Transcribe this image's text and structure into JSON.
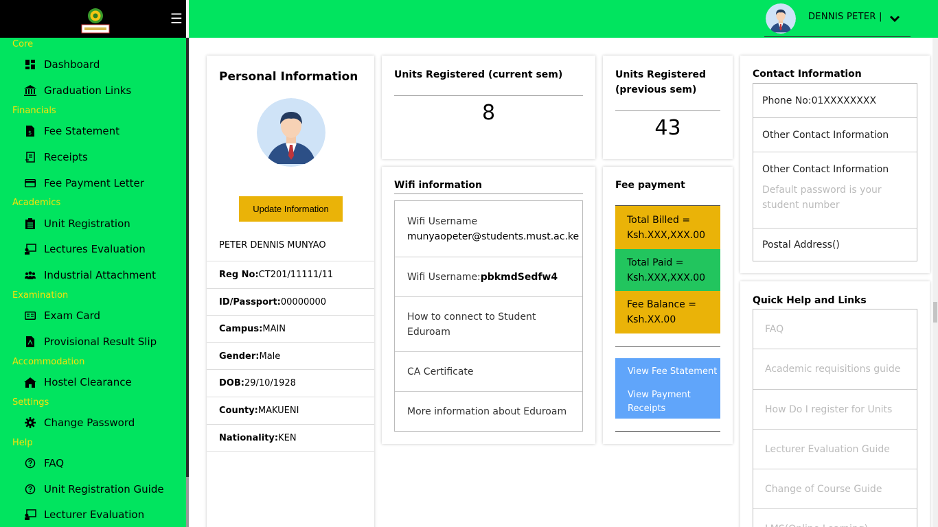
{
  "sidebar": {
    "menu_icon": "☰",
    "sections": [
      {
        "label": "Core",
        "items": [
          {
            "label": "Dashboard",
            "icon": "dashboard-icon"
          },
          {
            "label": "Graduation Links",
            "icon": "bank-icon"
          }
        ]
      },
      {
        "label": "Financials",
        "items": [
          {
            "label": "Fee Statement",
            "icon": "invoice-icon"
          },
          {
            "label": "Receipts",
            "icon": "receipt-icon"
          },
          {
            "label": "Fee Payment Letter",
            "icon": "credit-card-icon"
          }
        ]
      },
      {
        "label": "Academics",
        "items": [
          {
            "label": "Unit Registration",
            "icon": "clipboard-icon"
          },
          {
            "label": "Lectures Evaluation",
            "icon": "chalkboard-icon"
          },
          {
            "label": "Industrial Attachment",
            "icon": "users-icon"
          }
        ]
      },
      {
        "label": "Examination",
        "items": [
          {
            "label": "Exam Card",
            "icon": "id-card-icon"
          },
          {
            "label": "Provisional Result Slip",
            "icon": "pdf-file-icon"
          }
        ]
      },
      {
        "label": "Accommodation",
        "items": [
          {
            "label": "Hostel Clearance",
            "icon": "home-icon"
          }
        ]
      },
      {
        "label": "Settings",
        "items": [
          {
            "label": "Change Password",
            "icon": "gear-icon"
          }
        ]
      },
      {
        "label": "Help",
        "items": [
          {
            "label": "FAQ",
            "icon": "question-circle-icon"
          },
          {
            "label": "Unit Registration Guide",
            "icon": "question-circle-icon"
          },
          {
            "label": "Lecturer Evaluation",
            "icon": "chalkboard-icon"
          }
        ]
      }
    ]
  },
  "topbar": {
    "username": "DENNIS PETER |"
  },
  "personal": {
    "title": "Personal Information",
    "update_label": "Update Information",
    "name": "PETER DENNIS MUNYAO",
    "fields": [
      {
        "label": "Reg No:",
        "value": "CT201/11111/11"
      },
      {
        "label": "ID/Passport:",
        "value": "00000000"
      },
      {
        "label": "Campus:",
        "value": "MAIN"
      },
      {
        "label": "Gender:",
        "value": "Male"
      },
      {
        "label": "DOB:",
        "value": "29/10/1928"
      },
      {
        "label": "County:",
        "value": "MAKUENI"
      },
      {
        "label": "Nationality:",
        "value": "KEN"
      }
    ]
  },
  "units_current": {
    "title": "Units Registered (current sem)",
    "value": "8"
  },
  "units_previous": {
    "title_line1": "Units Registered",
    "title_line2": "(previous sem)",
    "value": "43"
  },
  "wifi": {
    "title": "Wifi information",
    "username1_label": "Wifi Username",
    "username1_value": "munyaopeter@students.must.ac.ke",
    "username2_label": "Wifi Username:",
    "username2_value": "pbkmdSedfw4",
    "connect_line1": "How to connect to Student",
    "connect_line2": "Eduroam",
    "ca_certificate": "CA Certificate",
    "more_info": "More information about Eduroam"
  },
  "fee": {
    "title": "Fee payment",
    "billed_label": "Total Billed =",
    "billed_value": "Ksh.XXX,XXX.00",
    "paid_label": "Total Paid =",
    "paid_value": "Ksh.XXX,XXX.00",
    "balance_label": "Fee Balance =",
    "balance_value": "Ksh.XX.00",
    "view_statement": "View Fee Statement",
    "view_receipts_line1": "View Payment",
    "view_receipts_line2": "Receipts",
    "colors": {
      "billed": "#eab308",
      "paid": "#22c55e",
      "balance": "#eab308",
      "button": "#60a5fa"
    }
  },
  "contact": {
    "title": "Contact Information",
    "phone": "Phone No:01XXXXXXXX",
    "other1": "Other Contact Information",
    "other2": "Other Contact Information",
    "hint_line1": "Default password is your",
    "hint_line2": "student number",
    "postal": "Postal Address()"
  },
  "quick_help": {
    "title": "Quick Help and Links",
    "links": [
      "FAQ",
      "Academic requisitions guide",
      "How Do I register for Units",
      "Lecturer Evaluation Guide",
      "Change of Course Guide",
      "LMS(Online Learning)"
    ]
  },
  "colors": {
    "accent_green": "#01e45f",
    "section_label": "#f5e20a",
    "update_button": "#eab308"
  }
}
